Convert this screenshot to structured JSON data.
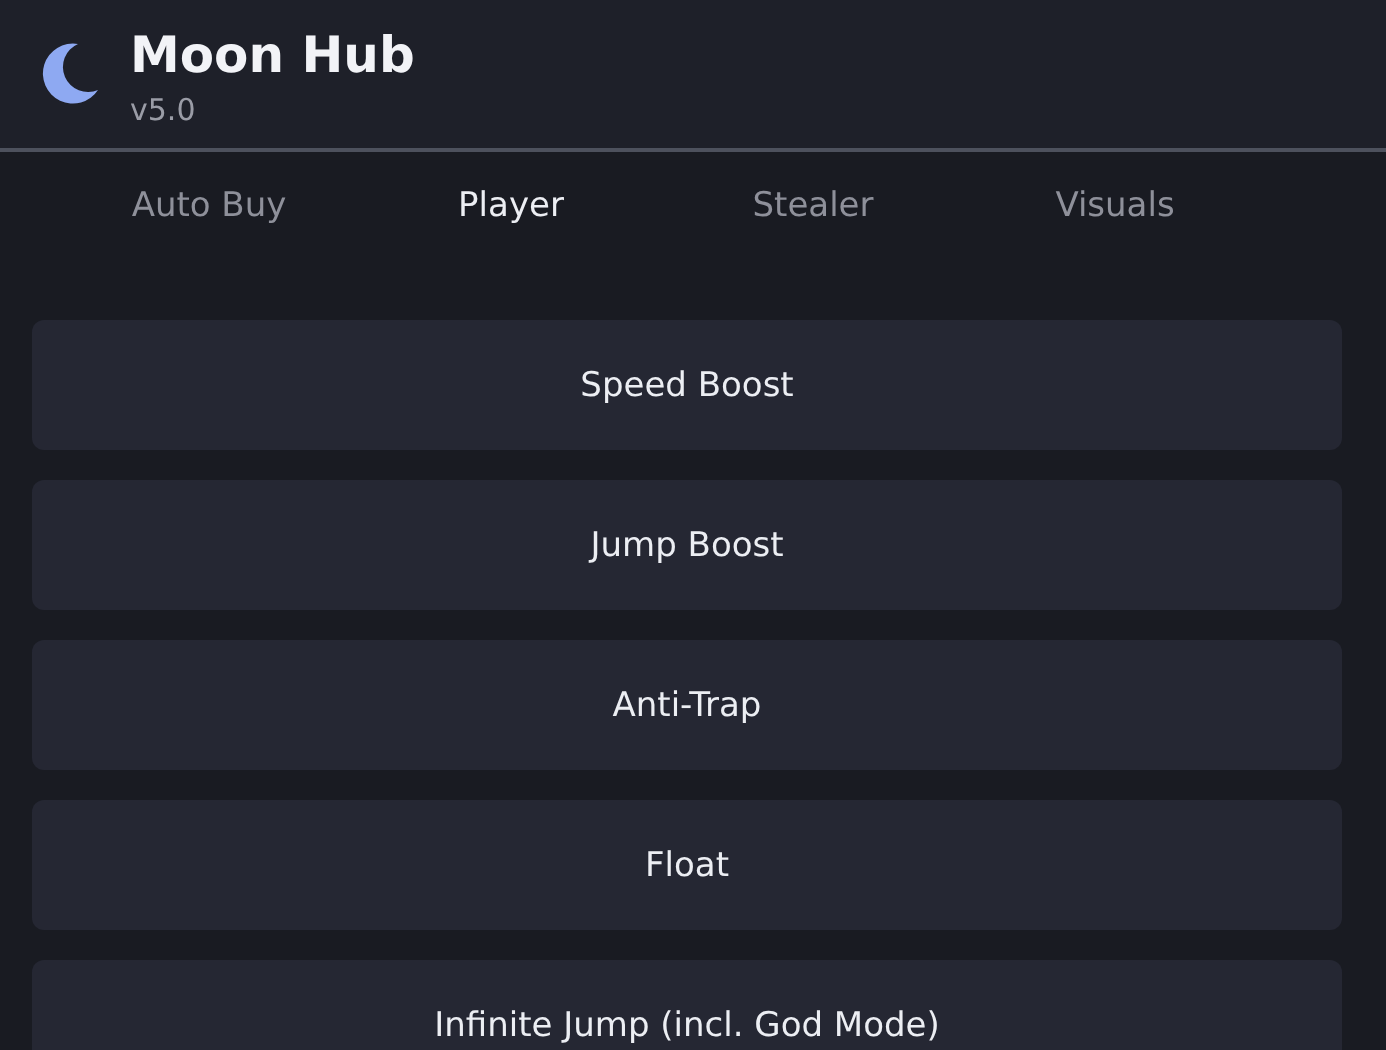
{
  "header": {
    "title": "Moon Hub",
    "version": "v5.0"
  },
  "tabs": [
    {
      "label": "Auto Buy",
      "selected": false
    },
    {
      "label": "Player",
      "selected": true
    },
    {
      "label": "Stealer",
      "selected": false
    },
    {
      "label": "Visuals",
      "selected": false
    }
  ],
  "buttons": [
    {
      "label": "Speed Boost"
    },
    {
      "label": "Jump Boost"
    },
    {
      "label": "Anti-Trap"
    },
    {
      "label": "Float"
    },
    {
      "label": "Infinite Jump (incl. God Mode)"
    }
  ]
}
